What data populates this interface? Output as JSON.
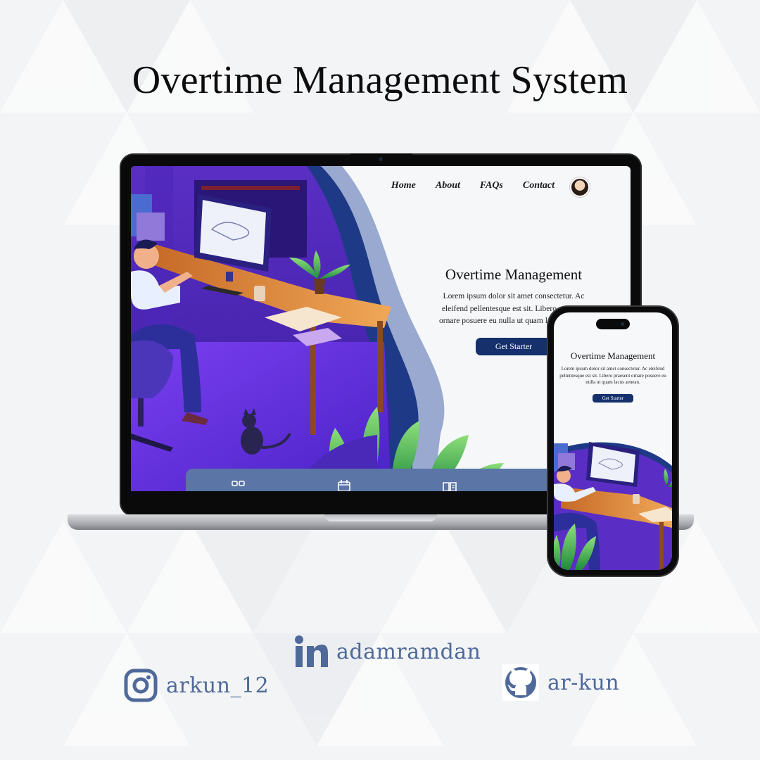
{
  "page": {
    "title": "Overtime Management System"
  },
  "laptop": {
    "nav": [
      "Home",
      "About",
      "FAQs",
      "Contact"
    ],
    "hero": {
      "title": "Overtime Management",
      "body": "Lorem ipsum dolor sit amet consectetur. Ac eleifend pellentesque est sit. Libero praesent ornare posuere eu nulla ut quam lacus aenean.",
      "button": "Get Starter"
    },
    "bottom_bar_icons": [
      "dashboard-icon",
      "calendar-icon",
      "book-icon",
      "documents-icon"
    ]
  },
  "phone": {
    "hero": {
      "title": "Overtime Management",
      "body": "Lorem ipsum dolor sit amet consectetur. Ac eleifend pellentesque est sit. Libero praesent ornare posuere eu nulla ut quam lacus aenean.",
      "button": "Get Starter"
    }
  },
  "socials": {
    "linkedin": {
      "icon": "linkedin-icon",
      "handle": "adamramdan"
    },
    "instagram": {
      "icon": "instagram-icon",
      "handle": "arkun_12"
    },
    "github": {
      "icon": "github-icon",
      "handle": "ar-kun"
    }
  },
  "colors": {
    "accent": "#15306b",
    "bar": "#5a75a6",
    "social_text": "#4f6a9a",
    "purple": "#6a2fd1"
  }
}
